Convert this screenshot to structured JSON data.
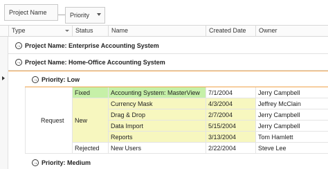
{
  "group_panel": {
    "chips": [
      {
        "label": "Project Name"
      },
      {
        "label": "Priority"
      }
    ]
  },
  "columns": [
    "Type",
    "Status",
    "Name",
    "Created Date",
    "Owner"
  ],
  "groups": {
    "project1": {
      "label": "Project Name: Enterprise Accounting System",
      "expander": "→"
    },
    "project2": {
      "label": "Project Name: Home-Office Accounting System",
      "expander": "→"
    },
    "priority_low": {
      "label": "Priority: Low",
      "expander": "→"
    },
    "priority_medium": {
      "label": "Priority: Medium",
      "expander": "→"
    }
  },
  "merged": {
    "type_request": "Request",
    "status_fixed": "Fixed",
    "status_new": "New",
    "status_rejected": "Rejected"
  },
  "rows": [
    {
      "name": "Accounting System: MasterView",
      "date": "7/1/2004",
      "owner": "Jerry Campbell"
    },
    {
      "name": "Currency Mask",
      "date": "4/3/2004",
      "owner": "Jeffrey McClain"
    },
    {
      "name": "Drag & Drop",
      "date": "2/7/2004",
      "owner": "Jerry Campbell"
    },
    {
      "name": "Data Import",
      "date": "5/15/2004",
      "owner": "Jerry Campbell"
    },
    {
      "name": "Reports",
      "date": "3/13/2004",
      "owner": "Tom Hamlett"
    },
    {
      "name": "New Users",
      "date": "2/22/2004",
      "owner": "Steve Lee"
    }
  ],
  "colors": {
    "fixed": "#c6f0a8",
    "new": "#f7f7bf",
    "selection": "#f0a24a"
  }
}
